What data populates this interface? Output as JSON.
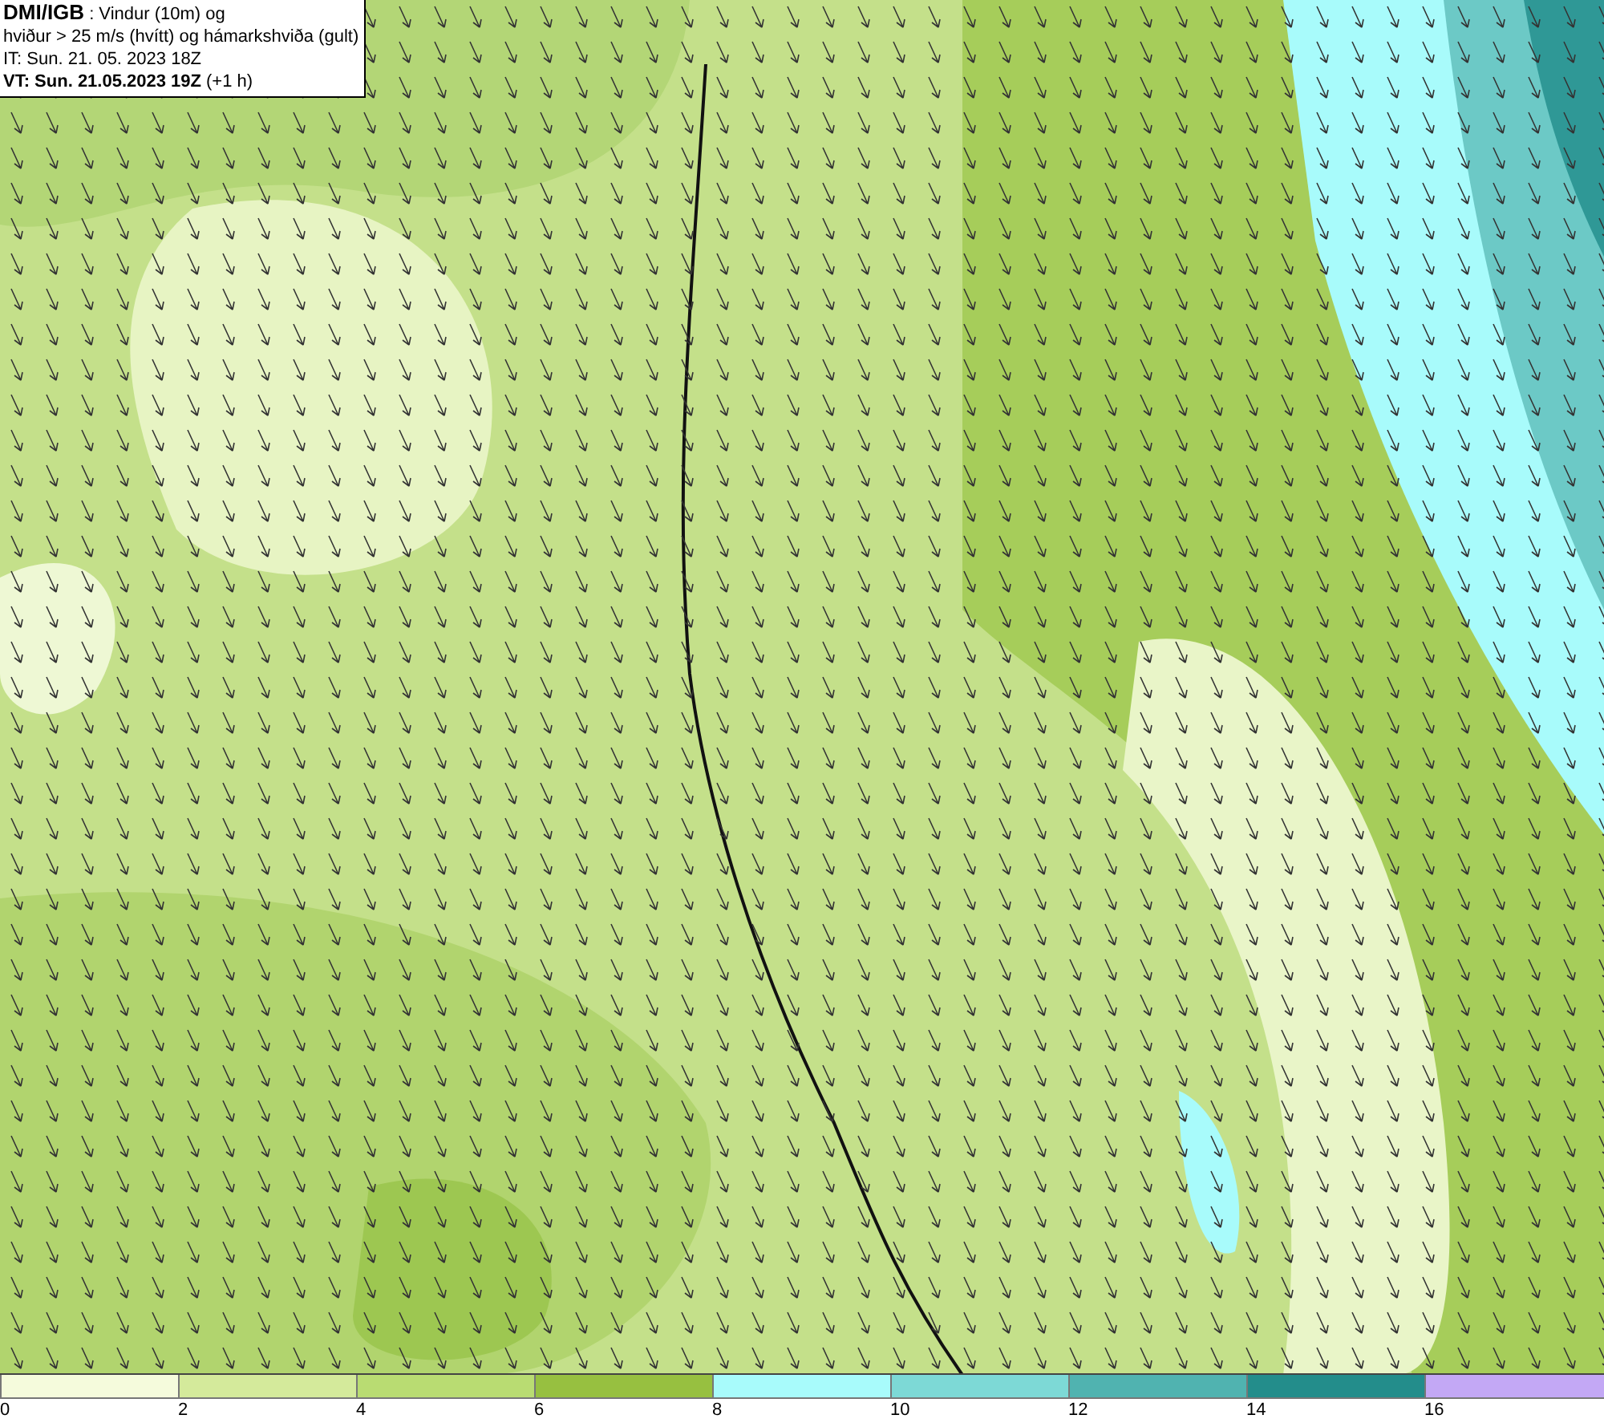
{
  "legend": {
    "source": "DMI/IGB",
    "title": ": Vindur (10m) og",
    "subtitle": "hviður > 25 m/s (hvítt) og hámarkshviða (gult)",
    "issue_time": "IT: Sun. 21. 05. 2023 18Z",
    "valid_time": "VT: Sun. 21.05.2023 19Z",
    "lead_time": "(+1 h)"
  },
  "colorbar": {
    "segments": [
      {
        "color": "#f5fbdc",
        "label": "0"
      },
      {
        "color": "#d4ea9b",
        "label": "2"
      },
      {
        "color": "#b9dc72",
        "label": "4"
      },
      {
        "color": "#97c040",
        "label": "6"
      },
      {
        "color": "#a8fbfb",
        "label": "8"
      },
      {
        "color": "#7dd9d6",
        "label": "10"
      },
      {
        "color": "#50b3b0",
        "label": "12"
      },
      {
        "color": "#238d8b",
        "label": "14"
      },
      {
        "color": "#c3a8f5",
        "label": "16"
      }
    ]
  }
}
